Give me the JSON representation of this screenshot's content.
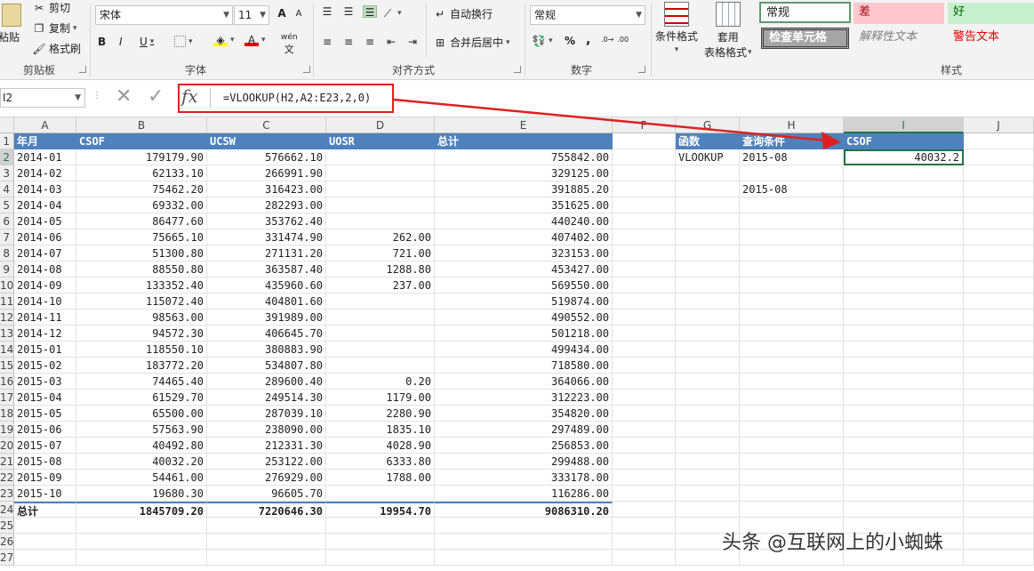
{
  "ribbon": {
    "clipboard": {
      "paste": "粘贴",
      "cut": "剪切",
      "copy": "复制",
      "format_painter": "格式刷",
      "label": "剪贴板"
    },
    "font": {
      "name": "宋体",
      "size": "11",
      "bold": "B",
      "italic": "I",
      "underline": "U",
      "label": "字体",
      "phonetic": "wén"
    },
    "alignment": {
      "wrap": "自动换行",
      "merge": "合并后居中",
      "label": "对齐方式"
    },
    "number": {
      "format": "常规",
      "percent": "%",
      "comma": ",",
      "label": "数字"
    },
    "styles": {
      "conditional": "条件格式",
      "table_line1": "套用",
      "table_line2": "表格格式",
      "normal": "常规",
      "bad": "差",
      "good": "好",
      "check_cell": "检查单元格",
      "explanatory": "解释性文本",
      "warning": "警告文本",
      "label": "样式"
    }
  },
  "formula_bar": {
    "name_box": "I2",
    "formula": "=VLOOKUP(H2,A2:E23,2,0)"
  },
  "grid": {
    "columns": [
      "A",
      "B",
      "C",
      "D",
      "E",
      "F",
      "G",
      "H",
      "I",
      "J"
    ],
    "row_numbers": [
      "1",
      "2",
      "3",
      "4",
      "5",
      "6",
      "7",
      "8",
      "9",
      "10",
      "11",
      "12",
      "13",
      "14",
      "15",
      "16",
      "17",
      "18",
      "19",
      "20",
      "21",
      "22",
      "23",
      "24",
      "25",
      "26",
      "27"
    ],
    "headers": [
      "年月",
      "CSOF",
      "UCSW",
      "UOSR",
      "总计"
    ],
    "rows": [
      [
        "2014-01",
        "179179.90",
        "576662.10",
        "",
        "755842.00"
      ],
      [
        "2014-02",
        "62133.10",
        "266991.90",
        "",
        "329125.00"
      ],
      [
        "2014-03",
        "75462.20",
        "316423.00",
        "",
        "391885.20"
      ],
      [
        "2014-04",
        "69332.00",
        "282293.00",
        "",
        "351625.00"
      ],
      [
        "2014-05",
        "86477.60",
        "353762.40",
        "",
        "440240.00"
      ],
      [
        "2014-06",
        "75665.10",
        "331474.90",
        "262.00",
        "407402.00"
      ],
      [
        "2014-07",
        "51300.80",
        "271131.20",
        "721.00",
        "323153.00"
      ],
      [
        "2014-08",
        "88550.80",
        "363587.40",
        "1288.80",
        "453427.00"
      ],
      [
        "2014-09",
        "133352.40",
        "435960.60",
        "237.00",
        "569550.00"
      ],
      [
        "2014-10",
        "115072.40",
        "404801.60",
        "",
        "519874.00"
      ],
      [
        "2014-11",
        "98563.00",
        "391989.00",
        "",
        "490552.00"
      ],
      [
        "2014-12",
        "94572.30",
        "406645.70",
        "",
        "501218.00"
      ],
      [
        "2015-01",
        "118550.10",
        "380883.90",
        "",
        "499434.00"
      ],
      [
        "2015-02",
        "183772.20",
        "534807.80",
        "",
        "718580.00"
      ],
      [
        "2015-03",
        "74465.40",
        "289600.40",
        "0.20",
        "364066.00"
      ],
      [
        "2015-04",
        "61529.70",
        "249514.30",
        "1179.00",
        "312223.00"
      ],
      [
        "2015-05",
        "65500.00",
        "287039.10",
        "2280.90",
        "354820.00"
      ],
      [
        "2015-06",
        "57563.90",
        "238090.00",
        "1835.10",
        "297489.00"
      ],
      [
        "2015-07",
        "40492.80",
        "212331.30",
        "4028.90",
        "256853.00"
      ],
      [
        "2015-08",
        "40032.20",
        "253122.00",
        "6333.80",
        "299488.00"
      ],
      [
        "2015-09",
        "54461.00",
        "276929.00",
        "1788.00",
        "333178.00"
      ],
      [
        "2015-10",
        "19680.30",
        "96605.70",
        "",
        "116286.00"
      ]
    ],
    "total": [
      "总计",
      "1845709.20",
      "7220646.30",
      "19954.70",
      "9086310.20"
    ],
    "lookup": {
      "g_header": "函数",
      "h_header": "查询条件",
      "i_header": "CSOF",
      "g_value": "VLOOKUP",
      "h_value": "2015-08",
      "i_value": "40032.2",
      "h_extra": "2015-08"
    }
  },
  "watermark": "头条 @互联网上的小蜘蛛",
  "colors": {
    "header_blue": "#4f81bd",
    "annotation_red": "#e02020",
    "select_green": "#217346"
  }
}
